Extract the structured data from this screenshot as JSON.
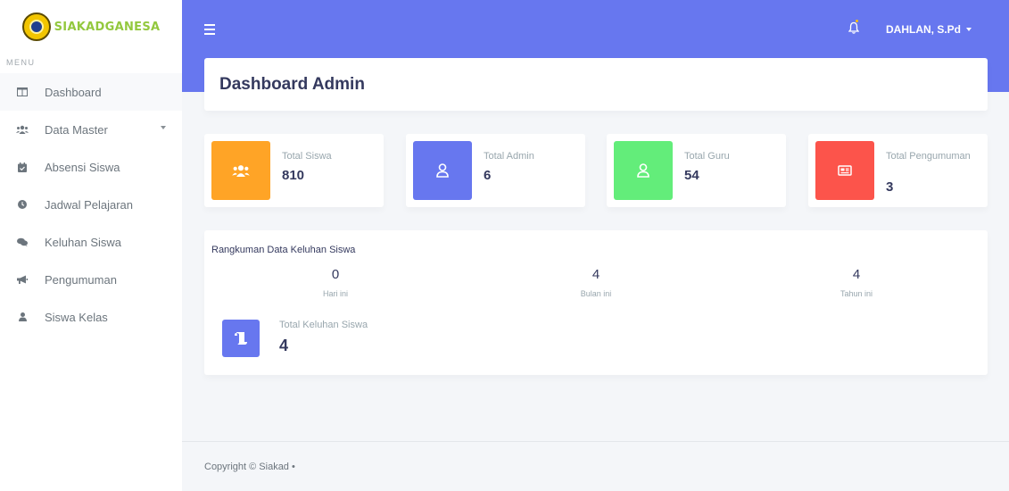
{
  "brand": {
    "name": "SIAKADGANESA",
    "logo_icon": "school-crest-logo"
  },
  "sidebar": {
    "menu_header": "MENU",
    "items": [
      {
        "label": "Dashboard",
        "icon": "columns-icon",
        "active": true
      },
      {
        "label": "Data Master",
        "icon": "users-icon",
        "has_caret": true
      },
      {
        "label": "Absensi Siswa",
        "icon": "calendar-check-icon"
      },
      {
        "label": "Jadwal Pelajaran",
        "icon": "clock-icon"
      },
      {
        "label": "Keluhan Siswa",
        "icon": "comments-icon"
      },
      {
        "label": "Pengumuman",
        "icon": "bullhorn-icon"
      },
      {
        "label": "Siswa Kelas",
        "icon": "user-icon"
      }
    ]
  },
  "topbar": {
    "user_name": "DAHLAN, S.Pd",
    "bell_icon": "bell-icon",
    "menu_icon": "hamburger-icon"
  },
  "page": {
    "title": "Dashboard Admin"
  },
  "stats": [
    {
      "label": "Total Siswa",
      "value": "810",
      "color": "#ffa426",
      "icon": "users-icon"
    },
    {
      "label": "Total Admin",
      "value": "6",
      "color": "#6777ef",
      "icon": "user-icon"
    },
    {
      "label": "Total Guru",
      "value": "54",
      "color": "#63ed7a",
      "icon": "user-icon"
    },
    {
      "label": "Total Pengumuman",
      "value": "3",
      "color": "#fc544b",
      "icon": "newspaper-icon"
    }
  ],
  "summary": {
    "title": "Rangkuman Data Keluhan Siswa",
    "periods": [
      {
        "value": "0",
        "label": "Hari ini"
      },
      {
        "value": "4",
        "label": "Bulan ini"
      },
      {
        "value": "4",
        "label": "Tahun ini"
      }
    ],
    "total_label": "Total Keluhan Siswa",
    "total_value": "4",
    "total_icon": "scroll-icon"
  },
  "footer": {
    "text": "Copyright © Siakad •"
  }
}
